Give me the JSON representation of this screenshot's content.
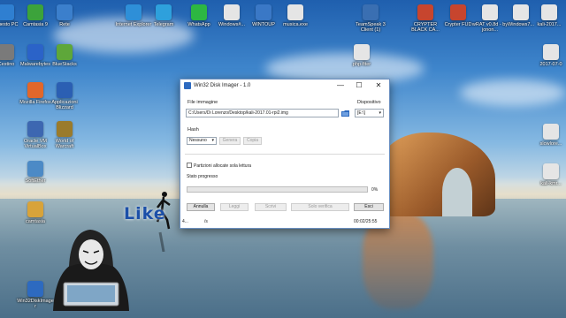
{
  "desktop": {
    "icons_left": [
      {
        "label": "Questo PC",
        "color": "#2f7fd1",
        "icon": "computer-icon"
      },
      {
        "label": "Camtasia 9",
        "color": "#3ca33b",
        "icon": "camtasia-icon"
      },
      {
        "label": "Rete",
        "color": "#3b7fcc",
        "icon": "network-icon"
      },
      {
        "label": "Cestino",
        "color": "#7a7a7a",
        "icon": "recycle-bin-icon"
      },
      {
        "label": "Malwarebytes",
        "color": "#2b63c8",
        "icon": "malwarebytes-icon"
      },
      {
        "label": "BlueStacks",
        "color": "#5ea73a",
        "icon": "bluestacks-icon"
      },
      {
        "label": "Mozilla Firefox",
        "color": "#e2672b",
        "icon": "firefox-icon"
      },
      {
        "label": "Applicazioni Blizzard",
        "color": "#2b5fb3",
        "icon": "blizzard-icon"
      },
      {
        "label": "Oracle VM VirtualBox",
        "color": "#3d67b1",
        "icon": "virtualbox-icon"
      },
      {
        "label": "World of Warcraft",
        "color": "#9a7b2c",
        "icon": "wow-icon"
      },
      {
        "label": "SoftEther",
        "color": "#4c8ac6",
        "icon": "softether-icon"
      },
      {
        "label": "camtasia",
        "color": "#d8a33a",
        "icon": "folder-icon"
      },
      {
        "label": "Win32DiskImager",
        "color": "#2d6ac0",
        "icon": "disk-imager-icon"
      }
    ],
    "icons_top": [
      {
        "label": "Internet Explorer",
        "color": "#2e8fd8",
        "icon": "ie-icon"
      },
      {
        "label": "Telegram",
        "color": "#2ea0dc",
        "icon": "telegram-icon"
      },
      {
        "label": "WhatsApp",
        "color": "#2db742",
        "icon": "whatsapp-icon"
      },
      {
        "label": "Windows#...",
        "color": "#e5e5e5",
        "icon": "file-icon"
      },
      {
        "label": "WINTOUP",
        "color": "#3a78c6",
        "icon": "winto-icon"
      },
      {
        "label": "musica.exe",
        "color": "#e5e5e5",
        "icon": "file-icon"
      }
    ],
    "icons_right": [
      {
        "label": "TeamSpeak 3 Client (1)",
        "color": "#3a6fb2",
        "icon": "teamspeak-icon"
      },
      {
        "label": "php-fiter",
        "color": "#e5e5e5",
        "icon": "file-icon"
      },
      {
        "label": "CRYPTER BLACK CA...",
        "color": "#c7452e",
        "icon": "crypter-icon"
      },
      {
        "label": "Crypter FUD",
        "color": "#c7452e",
        "icon": "crypter-icon"
      },
      {
        "label": "wRAT v0.8d - by jonon...",
        "color": "#e5e5e5",
        "icon": "file-icon"
      },
      {
        "label": "Windows7...",
        "color": "#e5e5e5",
        "icon": "file-icon"
      },
      {
        "label": "kali-2017...",
        "color": "#e5e5e5",
        "icon": "file-icon"
      },
      {
        "label": "2017-07-0",
        "color": "#e5e5e5",
        "icon": "file-icon"
      },
      {
        "label": "slowlore...",
        "color": "#e5e5e5",
        "icon": "file-icon"
      },
      {
        "label": "kali-kmr...",
        "color": "#e5e5e5",
        "icon": "file-icon"
      }
    ],
    "overlay_text": "Like"
  },
  "window": {
    "title": "Win32 Disk Imager - 1.0",
    "minimize": "—",
    "maximize": "☐",
    "close": "✕",
    "file_group_label": "File immagine",
    "file_path": "C:/Users/Di Lorenzo/Desktop/kali-2017.01-rpi2.img",
    "device_group_label": "Dispositivo",
    "device_value": "[E:\\]",
    "hash_label": "Hash",
    "hash_select": "Nessuno",
    "generate_label": "Genera",
    "copy_label": "Copia",
    "checkbox_label": "Partizioni allocate sola lettura",
    "progress_label": "Stato progresso",
    "progress_percent": "0%",
    "progress_value": 0,
    "cancel_label": "Annulla",
    "read_label": "Leggi",
    "write_label": "Scrivi",
    "verify_label": "Solo verifica",
    "exit_label": "Esci",
    "status_left": "4...",
    "status_left_percent": "/s",
    "status_time": "00:02/25:55"
  }
}
